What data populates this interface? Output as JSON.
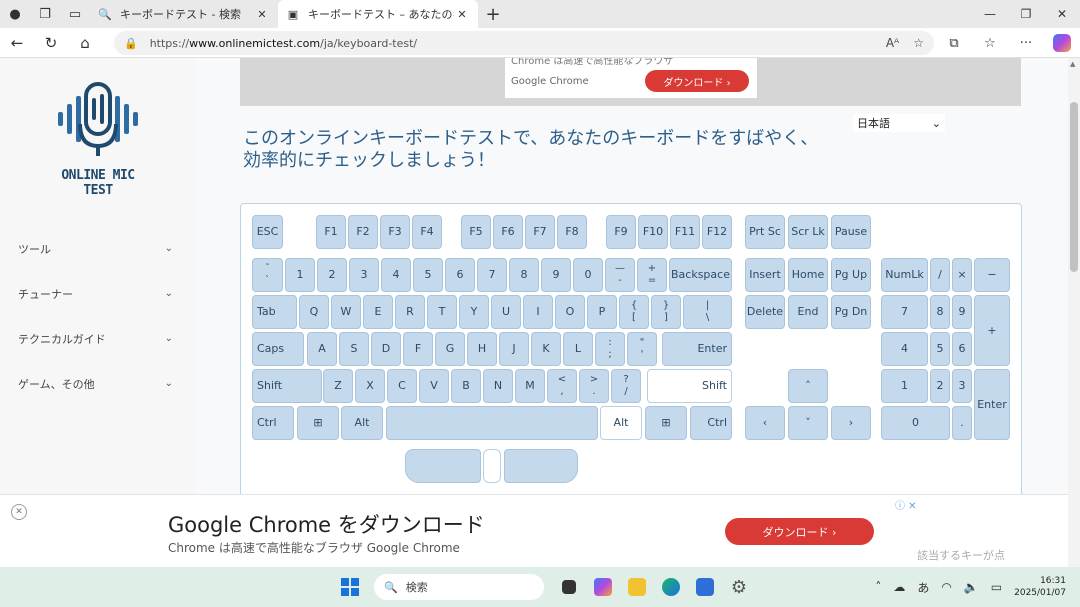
{
  "browser": {
    "tabs": [
      {
        "title": "キーボードテスト - 検索",
        "active": false
      },
      {
        "title": "キーボードテスト – あなたのキーボードを",
        "active": true
      }
    ],
    "url_prefix": "https://",
    "url_domain": "www.onlinemictest.com",
    "url_path": "/ja/keyboard-test/"
  },
  "sidebar": {
    "logo_text": "ONLINE MIC TEST",
    "items": [
      {
        "label": "ツール"
      },
      {
        "label": "チューナー"
      },
      {
        "label": "テクニカルガイド"
      },
      {
        "label": "ゲーム、その他"
      }
    ]
  },
  "ad_top": {
    "cut_text": "Chrome は高速で高性能なブラウザ",
    "brand": "Google Chrome",
    "button": "ダウンロード ›"
  },
  "language": {
    "selected": "日本語"
  },
  "headline": "このオンラインキーボードテストで、あなたのキーボードをすばやく、効率的にチェックしましょう！",
  "keyboard": {
    "row_fn": [
      "ESC",
      "F1",
      "F2",
      "F3",
      "F4",
      "F5",
      "F6",
      "F7",
      "F8",
      "F9",
      "F10",
      "F11",
      "F12"
    ],
    "row_num": [
      "1",
      "2",
      "3",
      "4",
      "5",
      "6",
      "7",
      "8",
      "9",
      "0"
    ],
    "row_q": [
      "Q",
      "W",
      "E",
      "R",
      "T",
      "Y",
      "U",
      "I",
      "O",
      "P"
    ],
    "row_a": [
      "A",
      "S",
      "D",
      "F",
      "G",
      "H",
      "J",
      "K",
      "L"
    ],
    "row_z": [
      "Z",
      "X",
      "C",
      "V",
      "B",
      "N",
      "M"
    ],
    "backtick": [
      "˜",
      "`"
    ],
    "minus": [
      "—",
      "-"
    ],
    "plus": [
      "+",
      "="
    ],
    "backspace": "Backspace",
    "tab": "Tab",
    "bracket_open": [
      "{",
      "["
    ],
    "bracket_close": [
      "}",
      "]"
    ],
    "backslash": [
      "|",
      "\\"
    ],
    "caps": "Caps",
    "semicolon": [
      ":",
      ";"
    ],
    "quote": [
      "\"",
      "'"
    ],
    "enter": "Enter",
    "shift": "Shift",
    "comma": [
      "<",
      ","
    ],
    "period": [
      ">",
      "."
    ],
    "slash": [
      "?",
      "/"
    ],
    "ctrl": "Ctrl",
    "alt": "Alt",
    "nav": [
      "Prt Sc",
      "Scr Lk",
      "Pause",
      "Insert",
      "Home",
      "Pg Up",
      "Delete",
      "End",
      "Pg Dn"
    ],
    "arrows": {
      "up": "˄",
      "left": "‹",
      "down": "˅",
      "right": "›"
    },
    "numpad": {
      "numlk": "NumLk",
      "divide": "/",
      "multiply": "×",
      "minus": "−",
      "n7": "7",
      "n8": "8",
      "n9": "9",
      "plus": "+",
      "n4": "4",
      "n5": "5",
      "n6": "6",
      "n1": "1",
      "n2": "2",
      "n3": "3",
      "enter": "Enter",
      "n0": "0",
      "dot": "."
    }
  },
  "ad_bottom": {
    "title": "Google Chrome をダウンロード",
    "subtitle": "Chrome は高速で高性能なブラウザ Google Chrome",
    "button": "ダウンロード ›",
    "side_text": "該当するキーが点"
  },
  "taskbar": {
    "search_placeholder": "検索",
    "ime": "あ",
    "time": "16:31",
    "date": "2025/01/07"
  },
  "colors": {
    "key_fill": "#c5d9ec",
    "key_text": "#2d4b66",
    "headline": "#2c5f8a",
    "ad_button": "#d93a36"
  }
}
